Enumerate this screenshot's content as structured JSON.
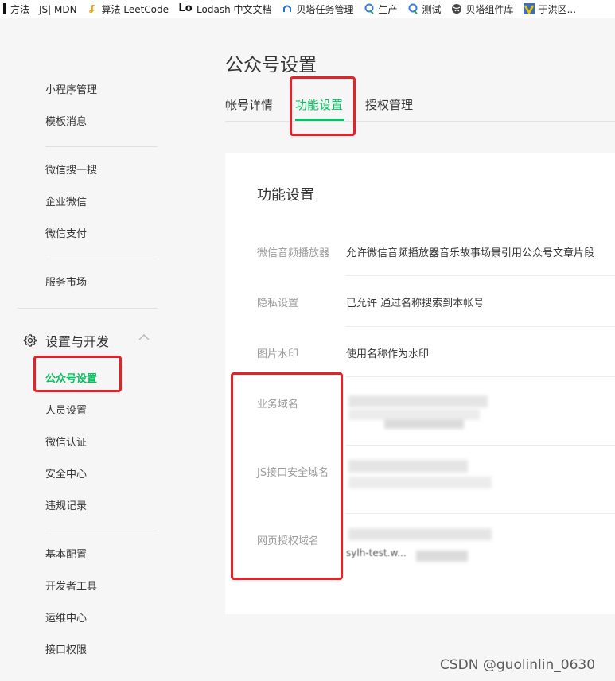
{
  "bookmarks": [
    {
      "icon": "bar-icon",
      "label": "方法 - JS| MDN"
    },
    {
      "icon": "algorithm-icon",
      "label": "算法 LeetCode"
    },
    {
      "icon": "lodash-logo-icon",
      "icon_text": "Lo",
      "label": "Lodash 中文文档"
    },
    {
      "icon": "cloud-icon",
      "label": "贝塔任务管理"
    },
    {
      "icon": "q-logo-icon",
      "label": "生产"
    },
    {
      "icon": "q-logo-icon",
      "label": "测试"
    },
    {
      "icon": "globe-icon",
      "label": "贝塔组件库"
    },
    {
      "icon": "v-logo-icon",
      "label": "于洪区..."
    }
  ],
  "sidebar": {
    "group1": [
      "小程序管理",
      "模板消息"
    ],
    "group2": [
      "微信搜一搜",
      "企业微信",
      "微信支付"
    ],
    "group3": [
      "服务市场"
    ],
    "section_title": "设置与开发",
    "group4": [
      "公众号设置",
      "人员设置",
      "微信认证",
      "安全中心",
      "违规记录"
    ],
    "group5": [
      "基本配置",
      "开发者工具",
      "运维中心",
      "接口权限"
    ],
    "active_item": "公众号设置"
  },
  "page": {
    "title": "公众号设置",
    "tabs": [
      "帐号详情",
      "功能设置",
      "授权管理"
    ],
    "active_tab": "功能设置"
  },
  "card": {
    "title": "功能设置",
    "rows": [
      {
        "label": "微信音频播放器",
        "value": "允许微信音频播放器音乐故事场景引用公众号文章片段"
      },
      {
        "label": "隐私设置",
        "value": "已允许 通过名称搜索到本帐号"
      },
      {
        "label": "图片水印",
        "value": "使用名称作为水印"
      },
      {
        "label": "业务域名",
        "value": ""
      },
      {
        "label": "JS接口安全域名",
        "value": ""
      },
      {
        "label": "网页授权域名",
        "value": "",
        "fragment": "sylh-test.w..."
      }
    ]
  },
  "watermark": "CSDN @guolinlin_0630",
  "colors": {
    "accent": "#07c160",
    "highlight": "#e0242a"
  }
}
